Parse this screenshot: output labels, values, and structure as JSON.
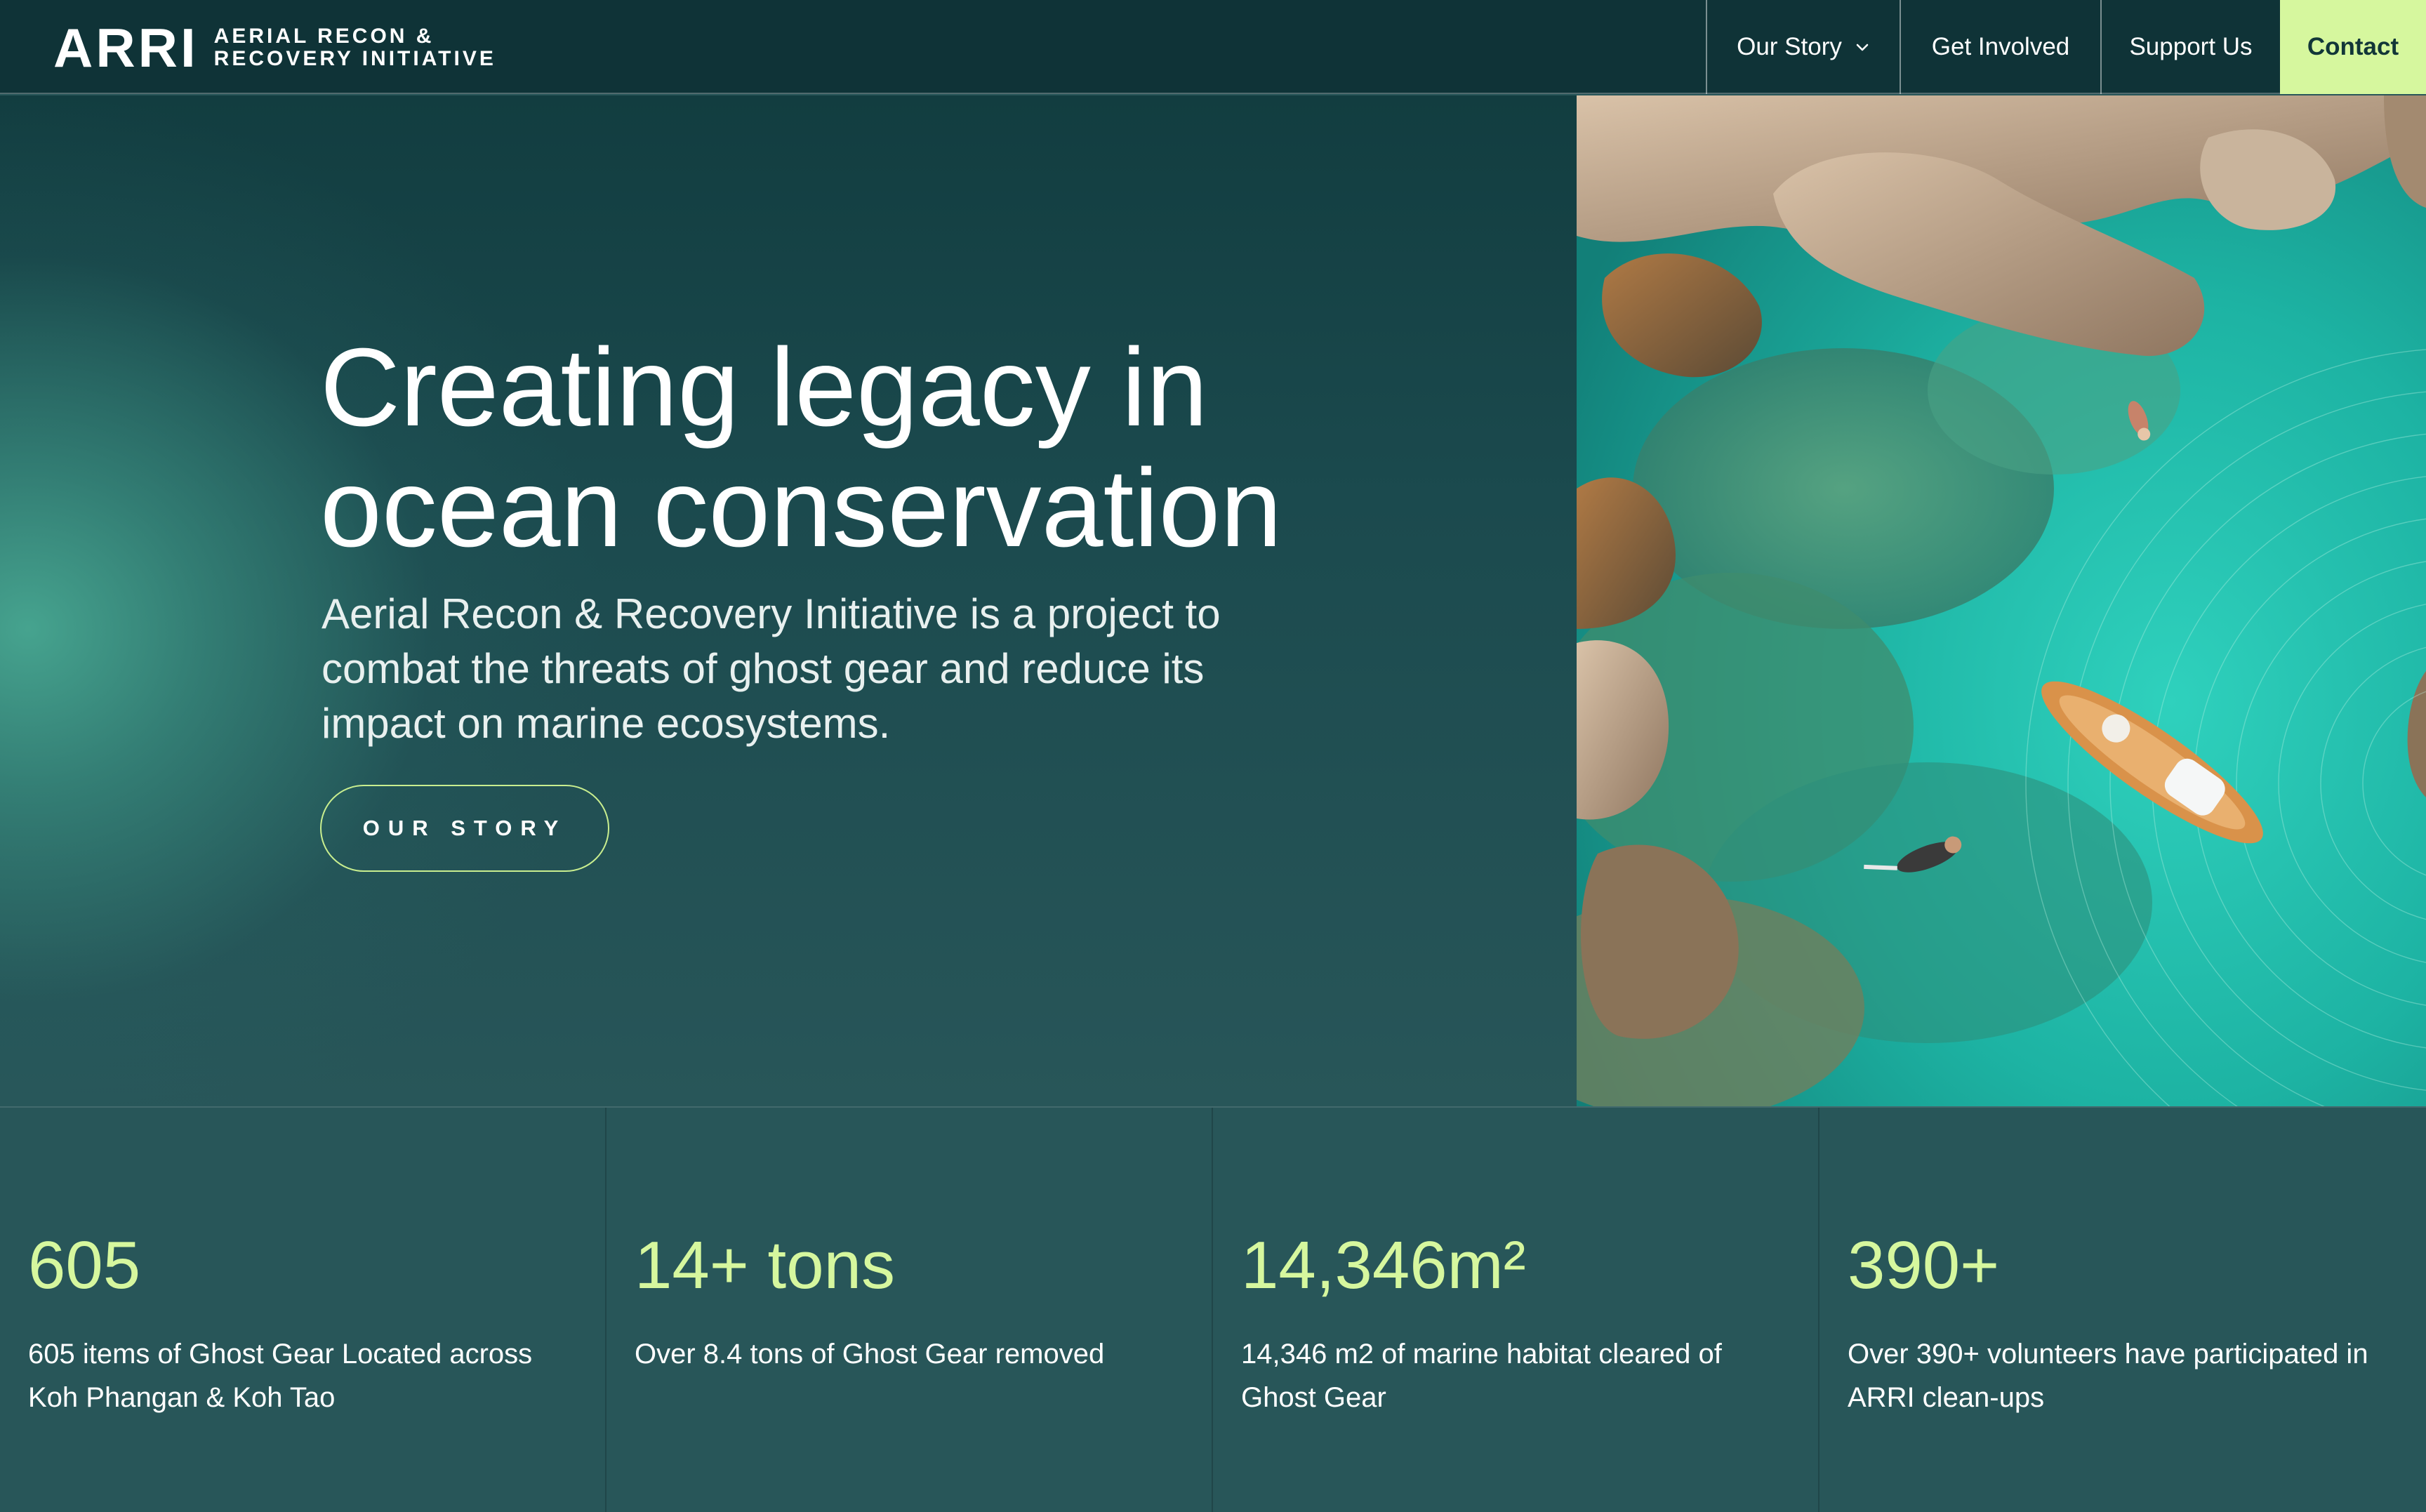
{
  "header": {
    "logo_mark": "ARRI",
    "logo_line1": "Aerial Recon &",
    "logo_line2": "Recovery Initiative",
    "nav": {
      "our_story": "Our Story",
      "get_involved": "Get Involved",
      "support_us": "Support Us",
      "contact": "Contact"
    }
  },
  "hero": {
    "title_line1": "Creating legacy in",
    "title_line2": "ocean conservation",
    "subtitle": "Aerial Recon & Recovery Initiative is a project to combat the threats of ghost gear and reduce its impact on marine ecosystems.",
    "button": "OUR STORY"
  },
  "stats": [
    {
      "value": "605",
      "description": "605 items of Ghost Gear Located across Koh Phangan & Koh Tao"
    },
    {
      "value": "14+ tons",
      "description": "Over 8.4 tons of Ghost Gear removed"
    },
    {
      "value": "14,346m²",
      "description": "14,346 m2 of marine habitat cleared of Ghost Gear"
    },
    {
      "value": "390+",
      "description": "Over 390+ volunteers have participated in ARRI clean-ups"
    }
  ],
  "colors": {
    "accent": "#d6f79e",
    "header_bg": "#0f3337",
    "page_bg": "#285659",
    "sea": "#1fa89a"
  }
}
